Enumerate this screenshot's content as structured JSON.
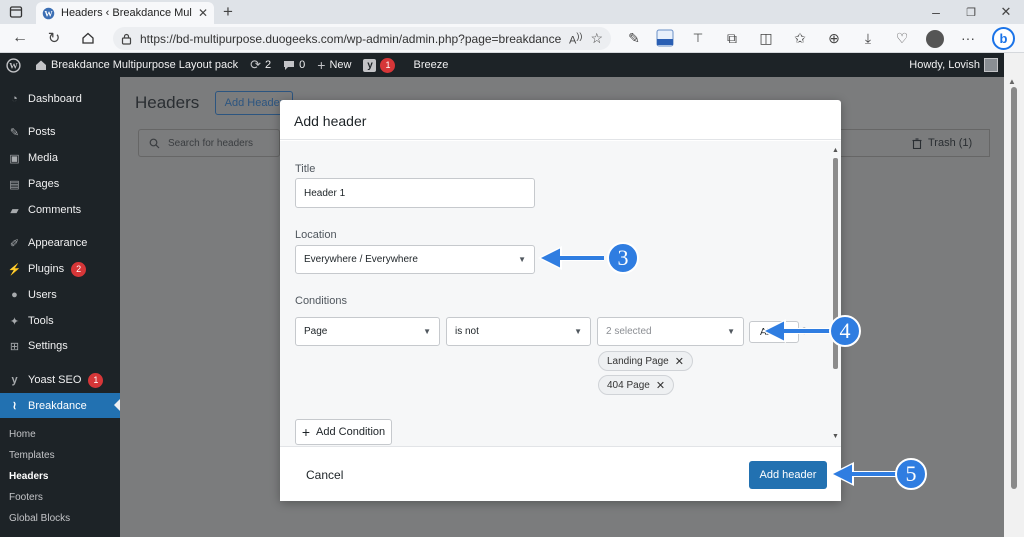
{
  "browser": {
    "tab_title": "Headers ‹ Breakdance Multipurp",
    "url": "https://bd-multipurpose.duogeeks.com/wp-admin/admin.php?page=breakdance_he..."
  },
  "adminbar": {
    "site_name": "Breakdance Multipurpose Layout pack",
    "updates_count": "2",
    "comments_count": "0",
    "new_label": "New",
    "yoast_count": "1",
    "breeze_label": "Breeze",
    "howdy": "Howdy, Lovish"
  },
  "sidebar": {
    "items": [
      {
        "label": "Dashboard",
        "icon": "dashboard-icon"
      },
      {
        "label": "Posts",
        "icon": "pin-icon"
      },
      {
        "label": "Media",
        "icon": "media-icon"
      },
      {
        "label": "Pages",
        "icon": "pages-icon"
      },
      {
        "label": "Comments",
        "icon": "comment-icon"
      },
      {
        "label": "Appearance",
        "icon": "brush-icon"
      },
      {
        "label": "Plugins",
        "icon": "plug-icon",
        "badge": "2"
      },
      {
        "label": "Users",
        "icon": "user-icon"
      },
      {
        "label": "Tools",
        "icon": "wrench-icon"
      },
      {
        "label": "Settings",
        "icon": "settings-icon"
      },
      {
        "label": "Yoast SEO",
        "icon": "yoast-icon",
        "badge": "1"
      },
      {
        "label": "Breakdance",
        "icon": "breakdance-icon"
      }
    ],
    "subitems": [
      "Home",
      "Templates",
      "Headers",
      "Footers",
      "Global Blocks"
    ]
  },
  "page": {
    "title": "Headers",
    "add_button": "Add Header",
    "search_placeholder": "Search for headers",
    "trash_label": "Trash (1)"
  },
  "modal": {
    "title": "Add header",
    "title_label": "Title",
    "title_value": "Header 1",
    "location_label": "Location",
    "location_value": "Everywhere / Everywhere",
    "conditions_label": "Conditions",
    "condition_field": "Page",
    "condition_operator": "is not",
    "condition_values_placeholder": "2 selected",
    "condition_and_button": "AND",
    "chips": [
      "Landing Page",
      "404 Page"
    ],
    "add_condition": "Add Condition",
    "cancel": "Cancel",
    "submit": "Add header"
  },
  "annotations": [
    "3",
    "4",
    "5"
  ],
  "colors": {
    "accent": "#2f7de1",
    "wp_dark": "#1d2327",
    "wp_blue": "#2271b1",
    "badge_red": "#d63638"
  }
}
